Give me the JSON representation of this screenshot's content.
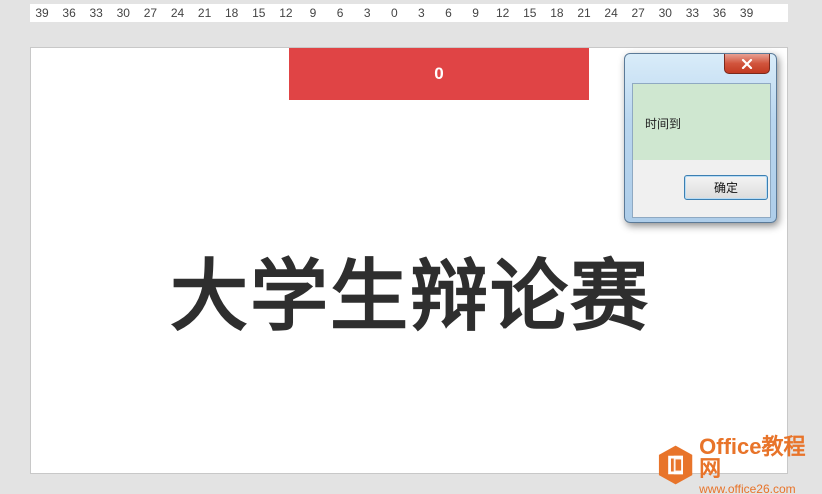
{
  "ruler": {
    "labels": [
      "39",
      "36",
      "33",
      "30",
      "27",
      "24",
      "21",
      "18",
      "15",
      "12",
      "9",
      "6",
      "3",
      "0",
      "3",
      "6",
      "9",
      "12",
      "15",
      "18",
      "21",
      "24",
      "27",
      "30",
      "33",
      "36",
      "39"
    ]
  },
  "slide": {
    "timer_value": "0",
    "title": "大学生辩论赛"
  },
  "dialog": {
    "message": "时间到",
    "ok_label": "确定",
    "close_glyph": "×"
  },
  "watermark": {
    "brand": "Office教程网",
    "url": "www.office26.com"
  },
  "colors": {
    "timer_bar": "#e04445",
    "dialog_message_bg": "#cfe7d0",
    "watermark": "#e8742a"
  }
}
